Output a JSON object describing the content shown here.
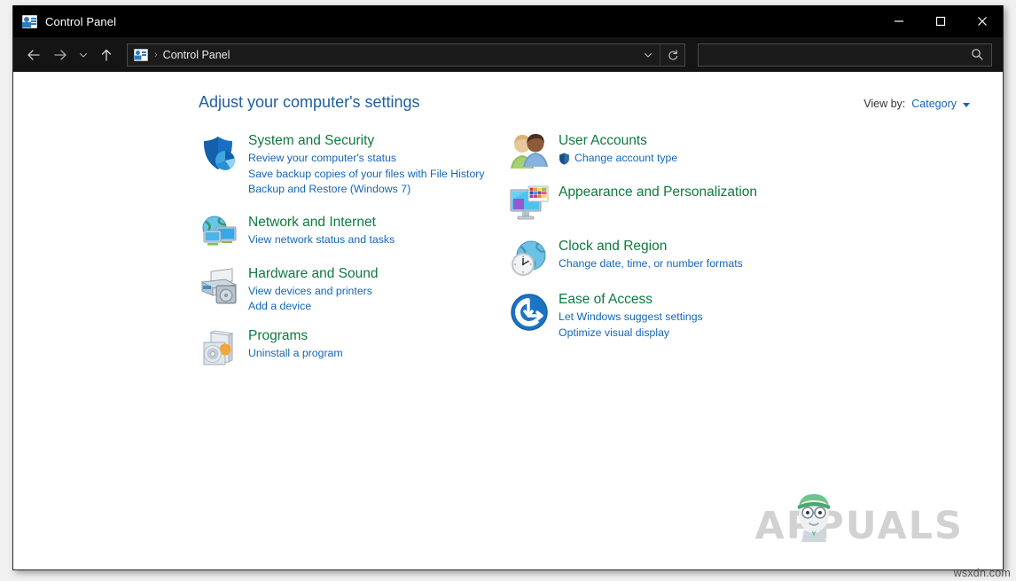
{
  "window": {
    "title": "Control Panel",
    "title_icon": "control-panel-icon",
    "controls": {
      "minimize": "minimize-icon",
      "maximize": "maximize-icon",
      "close": "close-icon"
    }
  },
  "toolbar": {
    "back": "back-arrow-icon",
    "forward": "forward-arrow-icon",
    "recent": "chevron-down-icon",
    "up": "up-arrow-icon",
    "breadcrumb_icon": "control-panel-icon",
    "breadcrumb_separator": "›",
    "breadcrumb_text": "Control Panel",
    "dropdown": "chevron-down-icon",
    "refresh": "refresh-icon",
    "search_value": "",
    "search_placeholder": "",
    "search_icon": "search-icon"
  },
  "header": {
    "title": "Adjust your computer's settings",
    "view_by_label": "View by:",
    "view_by_value": "Category"
  },
  "categories": {
    "left": [
      {
        "id": "system-and-security",
        "title": "System and Security",
        "icon": "shield-pie-icon",
        "links": [
          {
            "text": "Review your computer's status",
            "shield": false
          },
          {
            "text": "Save backup copies of your files with File History",
            "shield": false
          },
          {
            "text": "Backup and Restore (Windows 7)",
            "shield": false
          }
        ]
      },
      {
        "id": "network-and-internet",
        "title": "Network and Internet",
        "icon": "globe-monitors-icon",
        "links": [
          {
            "text": "View network status and tasks",
            "shield": false
          }
        ]
      },
      {
        "id": "hardware-and-sound",
        "title": "Hardware and Sound",
        "icon": "printer-speaker-icon",
        "links": [
          {
            "text": "View devices and printers",
            "shield": false
          },
          {
            "text": "Add a device",
            "shield": false
          }
        ]
      },
      {
        "id": "programs",
        "title": "Programs",
        "icon": "software-box-cd-icon",
        "links": [
          {
            "text": "Uninstall a program",
            "shield": false
          }
        ]
      }
    ],
    "right": [
      {
        "id": "user-accounts",
        "title": "User Accounts",
        "icon": "two-users-icon",
        "links": [
          {
            "text": "Change account type",
            "shield": true
          }
        ]
      },
      {
        "id": "appearance-and-personalization",
        "title": "Appearance and Personalization",
        "icon": "monitor-palette-icon",
        "links": []
      },
      {
        "id": "clock-and-region",
        "title": "Clock and Region",
        "icon": "globe-clock-icon",
        "links": [
          {
            "text": "Change date, time, or number formats",
            "shield": false
          }
        ]
      },
      {
        "id": "ease-of-access",
        "title": "Ease of Access",
        "icon": "accessibility-icon",
        "links": [
          {
            "text": "Let Windows suggest settings",
            "shield": false
          },
          {
            "text": "Optimize visual display",
            "shield": false
          }
        ]
      }
    ]
  },
  "watermark": {
    "text": "APPUALS",
    "mascot": "appuals-mascot-icon"
  },
  "site_tag": "wsxdn.com",
  "colors": {
    "titlebar_bg": "#000000",
    "addressbar_bg": "#141414",
    "category_title": "#0d7a3e",
    "link": "#1266bb",
    "page_title": "#1f5fa0",
    "watermark": "#d2d2d2"
  }
}
